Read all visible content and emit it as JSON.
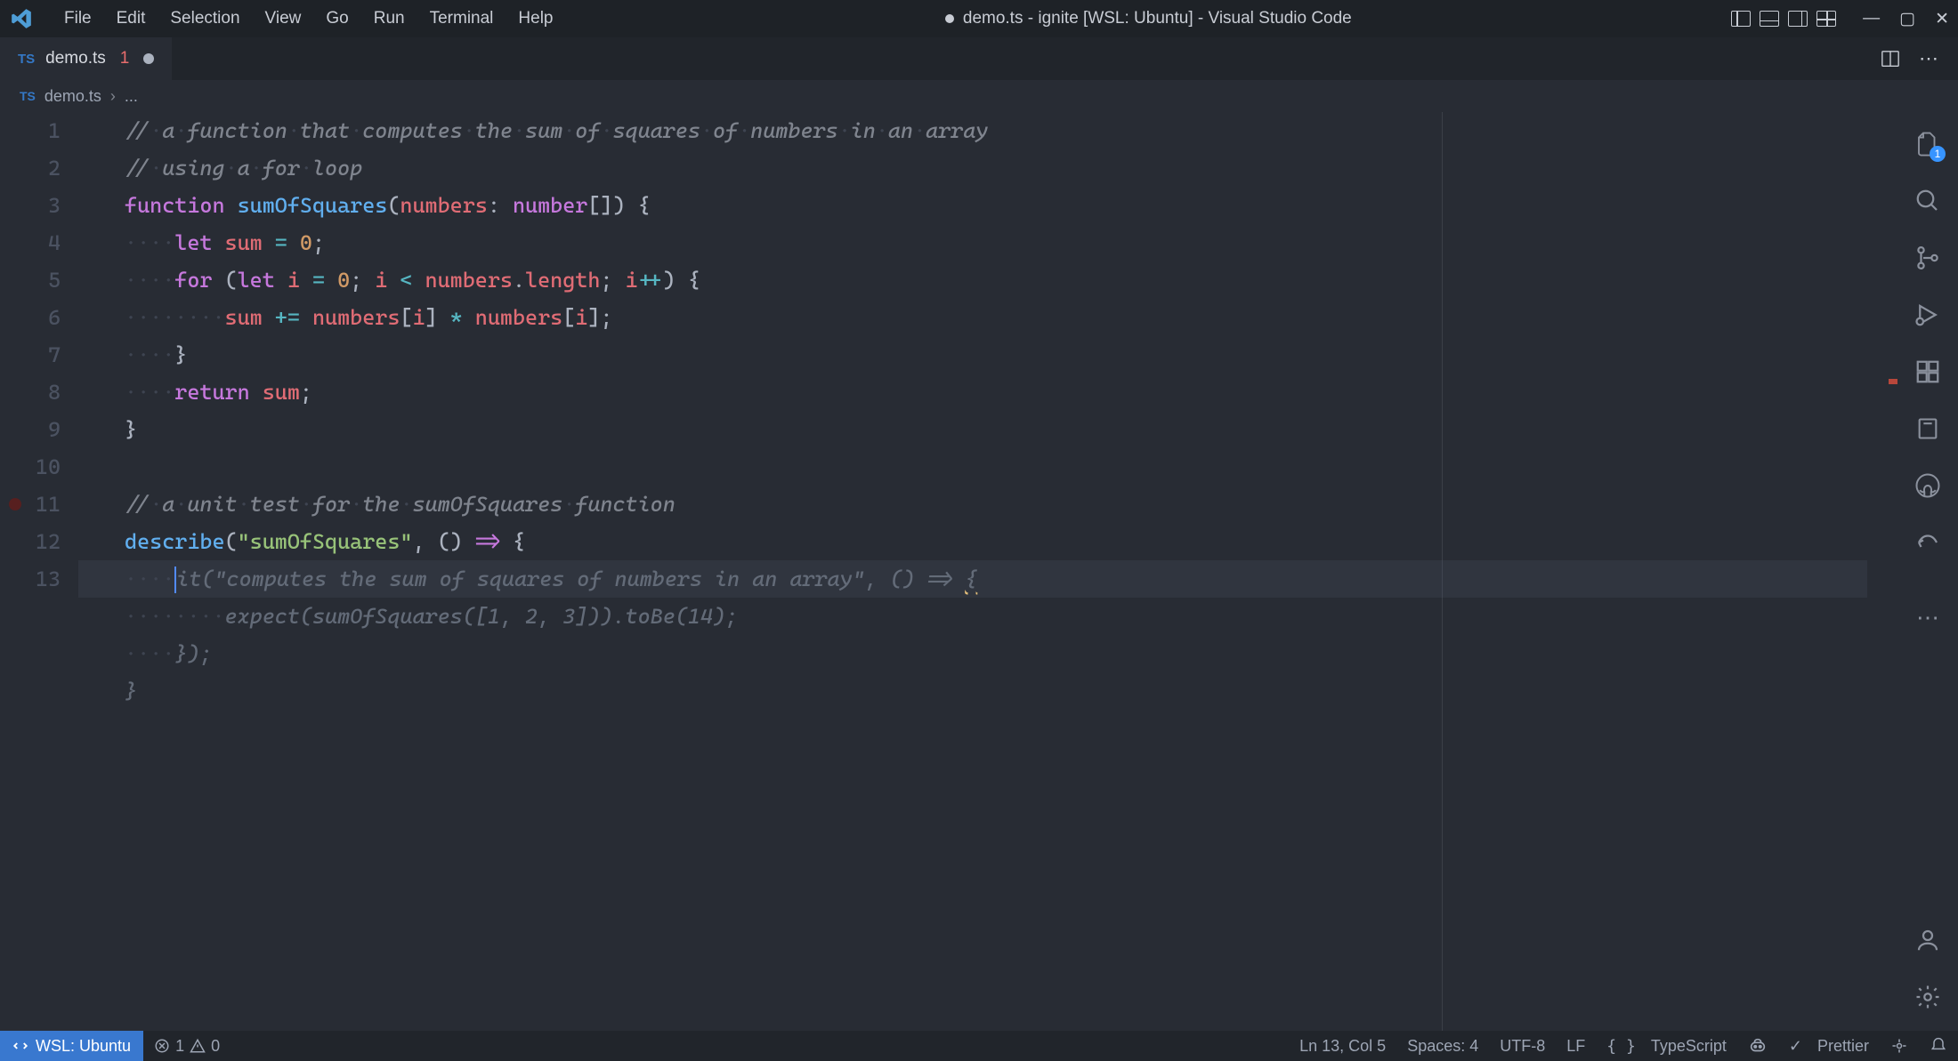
{
  "window": {
    "title": "demo.ts - ignite [WSL: Ubuntu] - Visual Studio Code",
    "dirty": true
  },
  "menu": [
    "File",
    "Edit",
    "Selection",
    "View",
    "Go",
    "Run",
    "Terminal",
    "Help"
  ],
  "tab": {
    "filename": "demo.ts",
    "problem_count": "1",
    "language_badge": "TS",
    "dirty": true
  },
  "breadcrumb": {
    "filename": "demo.ts",
    "lang": "TS",
    "rest": "..."
  },
  "activity": {
    "explorer_badge": "1"
  },
  "status": {
    "remote": "WSL: Ubuntu",
    "errors": "1",
    "warnings": "0",
    "cursor": "Ln 13, Col 5",
    "spaces": "Spaces: 4",
    "encoding": "UTF-8",
    "eol": "LF",
    "language": "TypeScript",
    "formatter": "Prettier"
  },
  "code": {
    "lines": [
      {
        "n": 1,
        "type": "comment",
        "text": "// a function that computes the sum of squares of numbers in an array"
      },
      {
        "n": 2,
        "type": "comment",
        "text": "// using a for loop"
      },
      {
        "n": 3,
        "type": "fn_decl",
        "kw": "function",
        "name": "sumOfSquares",
        "params": "numbers",
        "ptype": "number[]",
        "open": "{"
      },
      {
        "n": 4,
        "type": "let",
        "indent": 1,
        "kw": "let",
        "var": "sum",
        "eq": "=",
        "val": "0",
        "semi": ";"
      },
      {
        "n": 5,
        "type": "for",
        "indent": 1,
        "text_raw": "for (let i = 0; i < numbers.length; i++) {"
      },
      {
        "n": 6,
        "type": "stmt",
        "indent": 2,
        "text_raw": "sum += numbers[i] * numbers[i];"
      },
      {
        "n": 7,
        "type": "close",
        "indent": 1,
        "text": "}"
      },
      {
        "n": 8,
        "type": "return",
        "indent": 1,
        "kw": "return",
        "var": "sum",
        "semi": ";"
      },
      {
        "n": 9,
        "type": "close",
        "indent": 0,
        "text": "}"
      },
      {
        "n": 10,
        "type": "blank"
      },
      {
        "n": 11,
        "type": "comment",
        "text": "// a unit test for the sumOfSquares function",
        "bp": true
      },
      {
        "n": 12,
        "type": "describe",
        "fn": "describe",
        "str": "\"sumOfSquares\"",
        "arrow": "() => {"
      },
      {
        "n": 13,
        "type": "cursor",
        "indent": 1
      }
    ],
    "ghost": [
      {
        "indent": 1,
        "text": "it(\"computes the sum of squares of numbers in an array\", () => {",
        "sq": true
      },
      {
        "indent": 2,
        "text": "expect(sumOfSquares([1, 2, 3])).toBe(14);"
      },
      {
        "indent": 1,
        "text": "});"
      },
      {
        "indent": 0,
        "text": "}"
      }
    ]
  }
}
